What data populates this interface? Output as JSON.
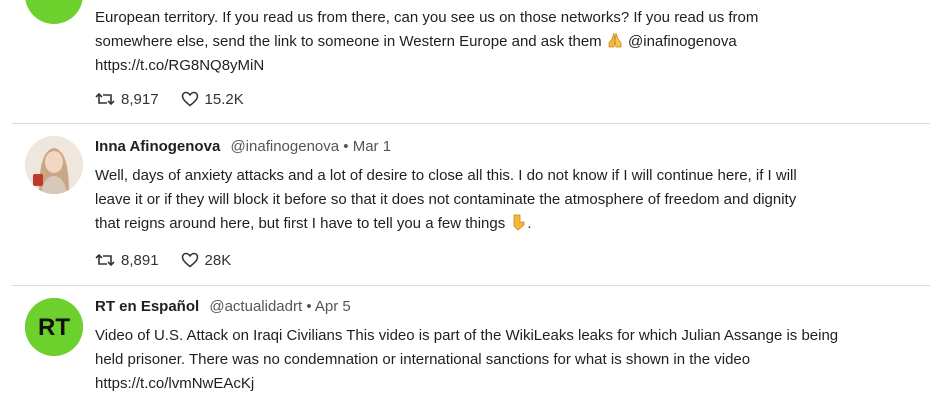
{
  "tweets": [
    {
      "line1": "European territory. If you read us from there, can you see us on those networks? If you read us from",
      "line2": "somewhere else, send the link to someone in Western Europe and ask them",
      "line2_suffix": "@inafinogenova",
      "link": "https://t.co/RG8NQ8yMiN",
      "retweets": "8,917",
      "likes": "15.2K"
    },
    {
      "author": "Inna Afinogenova",
      "handle": "@inafinogenova",
      "dot": "•",
      "date": "Mar 1",
      "line1": "Well, days of anxiety attacks and a lot of desire to close all this. I do not know if I will continue here, if I will",
      "line2": "leave it or if they will block it before so that it does not contaminate the atmosphere of freedom and dignity",
      "line3": "that reigns around here, but first I have to tell you a few things",
      "line3_suffix": ".",
      "retweets": "8,891",
      "likes": "28K"
    },
    {
      "author": "RT en Español",
      "handle": "@actualidadrt",
      "dot": "•",
      "date": "Apr 5",
      "avatar_text": "RT",
      "line1": "Video of U.S. Attack on Iraqi Civilians This video is part of the WikiLeaks leaks for which Julian Assange is being",
      "line2": "held prisoner. There was no condemnation or international sanctions for what is shown in the video",
      "link": "https://t.co/lvmNwEAcKj"
    }
  ],
  "icons": {
    "retweet": "retweet-icon",
    "like": "heart-icon",
    "emoji_1": "folded-hands-emoji",
    "emoji_2": "pointing-down-emoji"
  },
  "colors": {
    "rt_green": "#6cd02d",
    "text": "#1f1f1f",
    "muted": "#555555",
    "divider": "#dcdcdc"
  }
}
